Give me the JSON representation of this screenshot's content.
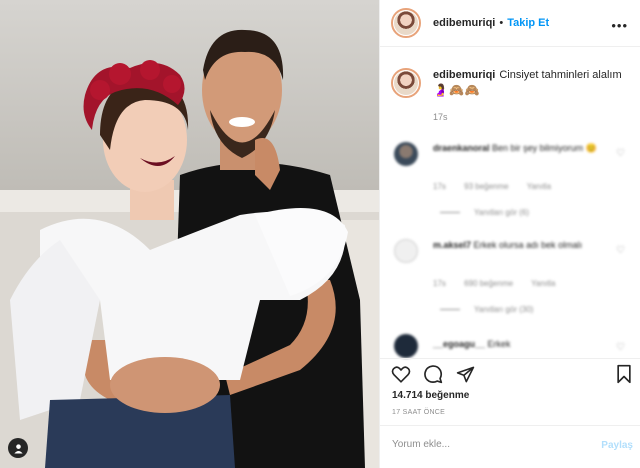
{
  "post": {
    "username": "edibemuriqi",
    "follow_label": "Takip Et",
    "separator": "•",
    "more_label": "•••"
  },
  "caption": {
    "username": "edibemuriqi",
    "text": "Cinsiyet tahminleri alalım",
    "emojis": "🤰🙈🙈",
    "time": "17s"
  },
  "comments": [
    {
      "username": "draenkanoral",
      "text": "Ben bir şey bilmiyorum 😊",
      "time": "17s",
      "likes": "93 beğenme",
      "reply": "Yanıtla",
      "view_replies": "Yanıtları gör (6)"
    },
    {
      "username": "m.aksel7",
      "text": "Erkek olursa adı bek olmalı",
      "time": "17s",
      "likes": "690 beğenme",
      "reply": "Yanıtla",
      "view_replies": "Yanıtları gör (30)"
    },
    {
      "username": "__egoagu__",
      "text": "Erkek"
    }
  ],
  "stats": {
    "likes": "14.714 beğenme",
    "time_ago": "17 SAAT ÖNCE"
  },
  "comment_box": {
    "placeholder": "Yorum ekle...",
    "share_label": "Paylaş"
  },
  "colors": {
    "link_blue": "#0095f6",
    "muted_text": "#8e8e8e",
    "share_disabled": "#b2dffc"
  },
  "icons": [
    "heart-icon",
    "comment-icon",
    "share-icon",
    "bookmark-icon",
    "more-icon",
    "user-icon"
  ]
}
